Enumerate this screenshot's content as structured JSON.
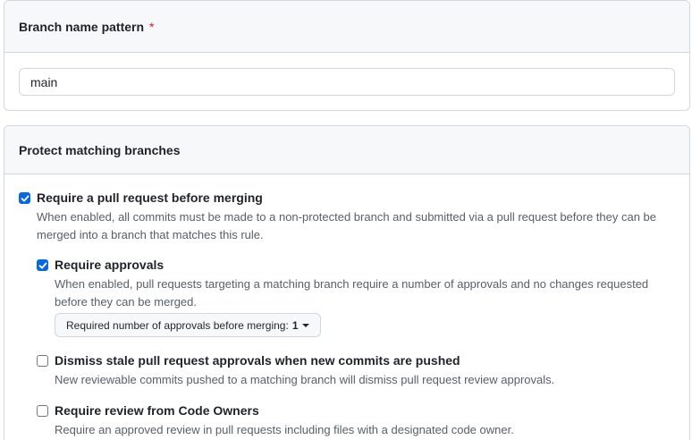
{
  "branch_pattern": {
    "label": "Branch name pattern",
    "required_mark": "*",
    "value": "main"
  },
  "protect": {
    "title": "Protect matching branches",
    "options": [
      {
        "title": "Require a pull request before merging",
        "description": "When enabled, all commits must be made to a non-protected branch and submitted via a pull request before they can be merged into a branch that matches this rule.",
        "checked": true
      },
      {
        "title": "Require approvals",
        "description": "When enabled, pull requests targeting a matching branch require a number of approvals and no changes requested before they can be merged.",
        "checked": true
      },
      {
        "title": "Dismiss stale pull request approvals when new commits are pushed",
        "description": "New reviewable commits pushed to a matching branch will dismiss pull request review approvals.",
        "checked": false
      },
      {
        "title": "Require review from Code Owners",
        "description": "Require an approved review in pull requests including files with a designated code owner.",
        "checked": false
      }
    ],
    "approvals_dropdown": {
      "label": "Required number of approvals before merging:",
      "value": "1"
    }
  },
  "colors": {
    "accent": "#0969da",
    "required": "#cf222e",
    "muted_text": "#57606a"
  }
}
